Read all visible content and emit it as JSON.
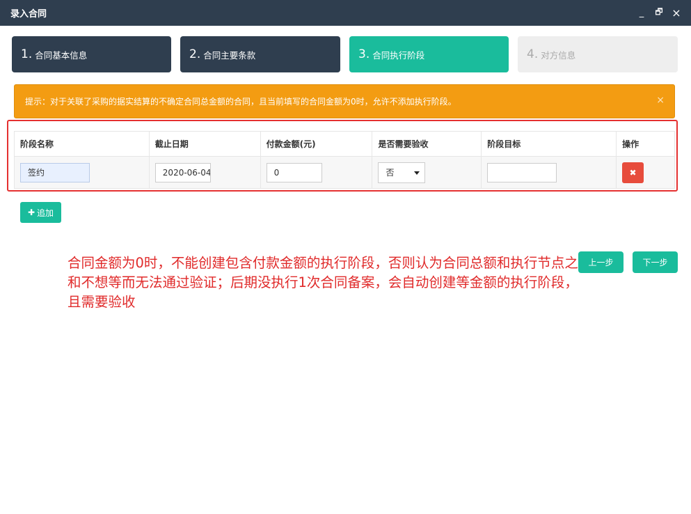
{
  "window": {
    "title": "录入合同",
    "minimize": "_",
    "restore": "🗗",
    "close": "×"
  },
  "steps": [
    {
      "num": "1.",
      "label": "合同基本信息",
      "state": "done"
    },
    {
      "num": "2.",
      "label": "合同主要条款",
      "state": "done"
    },
    {
      "num": "3.",
      "label": "合同执行阶段",
      "state": "active"
    },
    {
      "num": "4.",
      "label": "对方信息",
      "state": "disabled"
    }
  ],
  "alert": {
    "text": "提示：对于关联了采购的据实结算的不确定合同总金额的合同，且当前填写的合同金额为0时，允许不添加执行阶段。",
    "close": "×"
  },
  "table": {
    "headers": [
      "阶段名称",
      "截止日期",
      "付款金额(元)",
      "是否需要验收",
      "阶段目标",
      "操作"
    ],
    "row": {
      "stage_name": "签约",
      "deadline": "2020-06-04",
      "amount": "0",
      "need_accept": "否",
      "goal": "",
      "delete_icon": "✖"
    }
  },
  "add_button": {
    "icon": "✚",
    "label": "追加"
  },
  "annotation": "合同金额为0时，不能创建包含付款金额的执行阶段，否则认为合同总额和执行节点之和不想等而无法通过验证；后期没执行1次合同备案，会自动创建等金额的执行阶段，且需要验收",
  "nav": {
    "prev": "上一步",
    "next": "下一步"
  },
  "colors": {
    "titlebar": "#2f3e4f",
    "accent": "#1abc9c",
    "warning": "#f39c12",
    "danger": "#e74c3c",
    "annotation": "#e02a2a"
  }
}
